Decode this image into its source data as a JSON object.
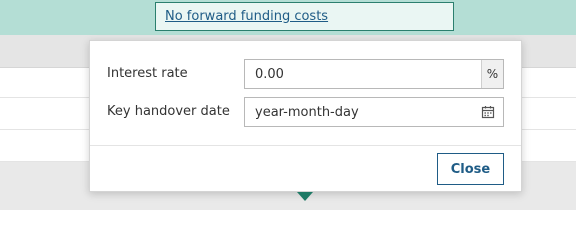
{
  "header": {
    "link_text": "No forward funding costs"
  },
  "popup": {
    "interest_rate": {
      "label": "Interest rate",
      "value": "0.00",
      "unit": "%"
    },
    "key_handover_date": {
      "label": "Key handover date",
      "placeholder": "year-month-day",
      "icon": "calendar-icon"
    },
    "close_label": "Close"
  },
  "colors": {
    "topbar": "#b4ded5",
    "link": "#1f5c86",
    "pointer": "#1f7a66"
  }
}
